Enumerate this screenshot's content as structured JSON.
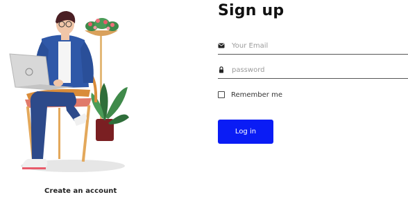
{
  "title": "Sign up",
  "email_field": {
    "placeholder": "Your Email",
    "icon": "envelope-icon"
  },
  "password_field": {
    "placeholder": "password",
    "icon": "lock-icon"
  },
  "remember": {
    "label": "Remember me",
    "checked": false
  },
  "login_button": {
    "label": "Log in",
    "color": "#0a1cf5"
  },
  "create_account_link": "Create an account"
}
